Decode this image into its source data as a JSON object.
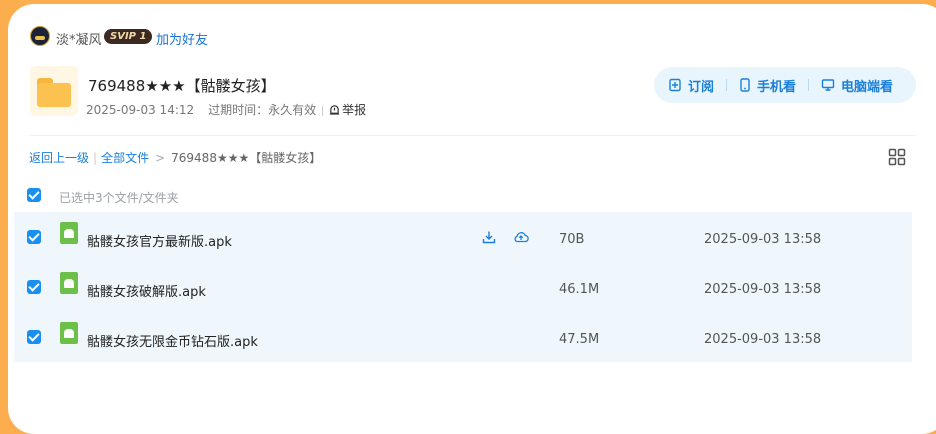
{
  "user": {
    "name": "淡*凝风",
    "badge": "SVIP 1",
    "add_friend": "加为好友"
  },
  "folder": {
    "title": "769488★★★【骷髅女孩】",
    "created": "2025-09-03 14:12",
    "expire_label": "过期时间：",
    "expire_value": "永久有效",
    "report": "举报"
  },
  "actions": {
    "subscribe": "订阅",
    "mobile": "手机看",
    "desktop": "电脑端看"
  },
  "breadcrumb": {
    "back": "返回上一级",
    "all_files": "全部文件",
    "current": "769488★★★【骷髅女孩】"
  },
  "selection": {
    "text": "已选中3个文件/文件夹"
  },
  "files": [
    {
      "name": "骷髅女孩官方最新版.apk",
      "size": "70B",
      "date": "2025-09-03 13:58"
    },
    {
      "name": "骷髅女孩破解版.apk",
      "size": "46.1M",
      "date": "2025-09-03 13:58"
    },
    {
      "name": "骷髅女孩无限金币钻石版.apk",
      "size": "47.5M",
      "date": "2025-09-03 13:58"
    }
  ],
  "colors": {
    "accent": "#1a80d9",
    "page_bg": "#fcae4f",
    "row_bg": "#eff7fd",
    "folder": "#fcc24f"
  },
  "icons": [
    "avatar",
    "folder-icon",
    "subscribe-icon",
    "mobile-icon",
    "desktop-icon",
    "report-icon",
    "grid-view-icon",
    "apk-icon",
    "download-icon",
    "save-to-cloud-icon"
  ]
}
